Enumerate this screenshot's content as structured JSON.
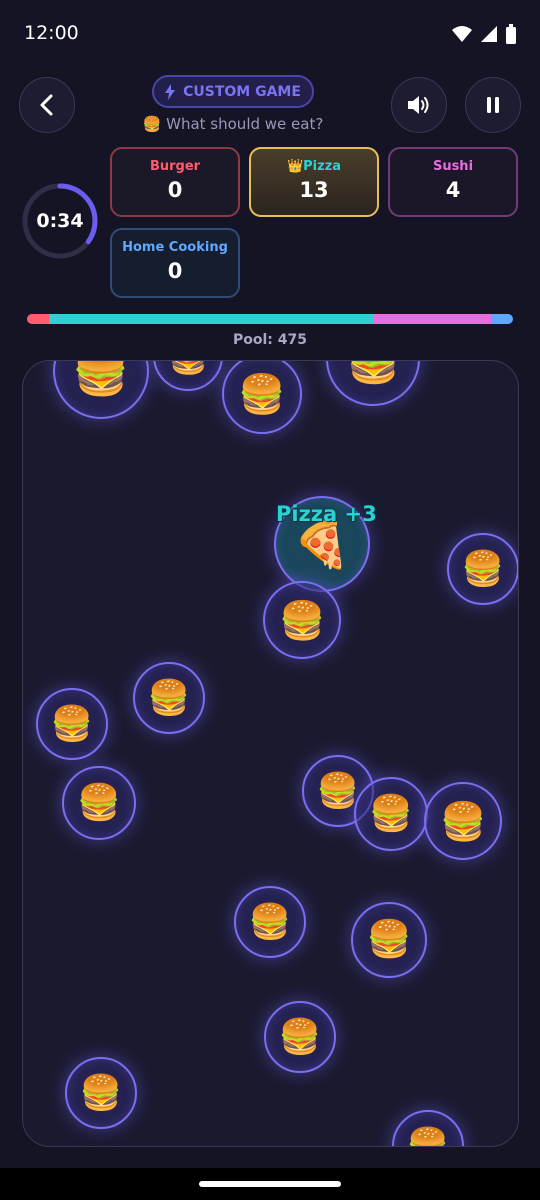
{
  "status_bar": {
    "time": "12:00",
    "icons": [
      "wifi-icon",
      "signal-icon",
      "battery-icon"
    ]
  },
  "header": {
    "badge_label": "CUSTOM GAME",
    "badge_icon": "lightning-icon",
    "question": "🍔 What should we eat?",
    "buttons": [
      "back-button",
      "sound-button",
      "pause-button"
    ]
  },
  "timer": {
    "text": "0:34",
    "fraction": 0.35
  },
  "scores": [
    {
      "name": "Burger",
      "value": "0",
      "color": "#ff5d6e",
      "border": "#8a3a48",
      "bg": "#1b1828",
      "leader": false
    },
    {
      "name": "👑Pizza",
      "value": "13",
      "color": "#2ed0d4",
      "border": "#e7be58",
      "bg": "#3b3226",
      "leader": true
    },
    {
      "name": "Sushi",
      "value": "4",
      "color": "#e66ee0",
      "border": "#6f3c78",
      "bg": "#1c1728",
      "leader": false
    },
    {
      "name": "Home Cooking",
      "value": "0",
      "color": "#5ea8ff",
      "border": "#2f4c7a",
      "bg": "#161d2e",
      "leader": false
    }
  ],
  "pool": {
    "label": "Pool: 475",
    "segments": [
      {
        "color": "#ff5d6e",
        "share": 0.045
      },
      {
        "color": "#2ed0d4",
        "share": 0.67
      },
      {
        "color": "#e66ee0",
        "share": 0.24
      },
      {
        "color": "#5ea8ff",
        "share": 0.045
      }
    ]
  },
  "arena": {
    "floating_text": "Pizza +3",
    "bubble_item": "🍔",
    "special_bubble_item": "🍕"
  },
  "colors": {
    "background": "#151425",
    "accent": "#7a6ff0",
    "pizza": "#2ed0d4"
  }
}
